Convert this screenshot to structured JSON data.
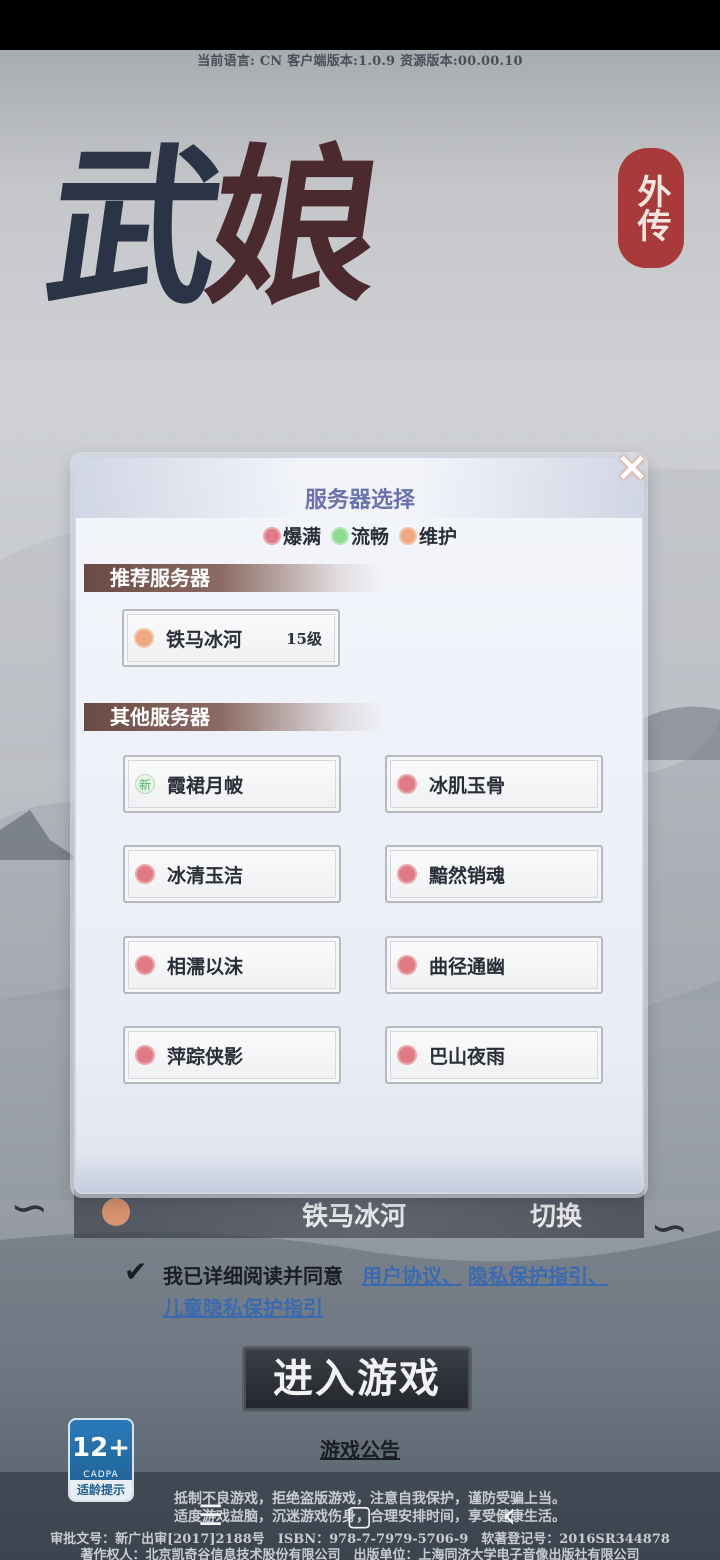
{
  "header": {
    "version_info": "当前语言: CN   客户端版本:1.0.9   资源版本:00.00.10"
  },
  "logo": {
    "title_part1": "武",
    "title_part2": "娘",
    "seal": "外传"
  },
  "dialog": {
    "title": "服务器选择",
    "close_icon": "×",
    "legend": [
      {
        "label": "爆满",
        "color": "#e07a84"
      },
      {
        "label": "流畅",
        "color": "#8fdc96"
      },
      {
        "label": "维护",
        "color": "#f0a880"
      }
    ],
    "recommended": {
      "heading": "推荐服务器",
      "server": {
        "name": "铁马冰河",
        "level": "15级",
        "status": "维护"
      }
    },
    "others": {
      "heading": "其他服务器",
      "servers": [
        {
          "name": "霞裙月帔",
          "status": "新"
        },
        {
          "name": "冰肌玉骨",
          "status": "爆满"
        },
        {
          "name": "冰清玉洁",
          "status": "爆满"
        },
        {
          "name": "黯然销魂",
          "status": "爆满"
        },
        {
          "name": "相濡以沫",
          "status": "爆满"
        },
        {
          "name": "曲径通幽",
          "status": "爆满"
        },
        {
          "name": "萍踪侠影",
          "status": "爆满"
        },
        {
          "name": "巴山夜雨",
          "status": "爆满"
        }
      ],
      "new_badge": "新"
    }
  },
  "current_server": {
    "name": "铁马冰河",
    "switch_label": "切换"
  },
  "agreement": {
    "checked": true,
    "text": "我已详细阅读并同意",
    "link1": "用户协议、",
    "link2": "隐私保护指引、",
    "link3": "儿童隐私保护指引"
  },
  "enter_button": "进入游戏",
  "notice_link": "游戏公告",
  "age_rating": {
    "number": "12+",
    "org": "CADPA",
    "label": "适龄提示"
  },
  "footer": {
    "line1": "抵制不良游戏，拒绝盗版游戏，注意自我保护，谨防受骗上当。",
    "line2": "适度游戏益脑，沉迷游戏伤身，合理安排时间，享受健康生活。",
    "line3": "审批文号：新广出审[2017]2188号　ISBN：978-7-7979-5706-9　软著登记号：2016SR344878",
    "line4": "著作权人：北京凯奇谷信息技术股份有限公司　出版单位：上海同济大学电子音像出版社有限公司"
  },
  "navbar": {
    "menu_icon": "☰",
    "home_icon": "▢",
    "back_icon": "‹"
  },
  "colors": {
    "status_full": "#e07a84",
    "status_smooth": "#8fdc96",
    "status_maintenance": "#f0a880",
    "link": "#3c6ab0"
  }
}
